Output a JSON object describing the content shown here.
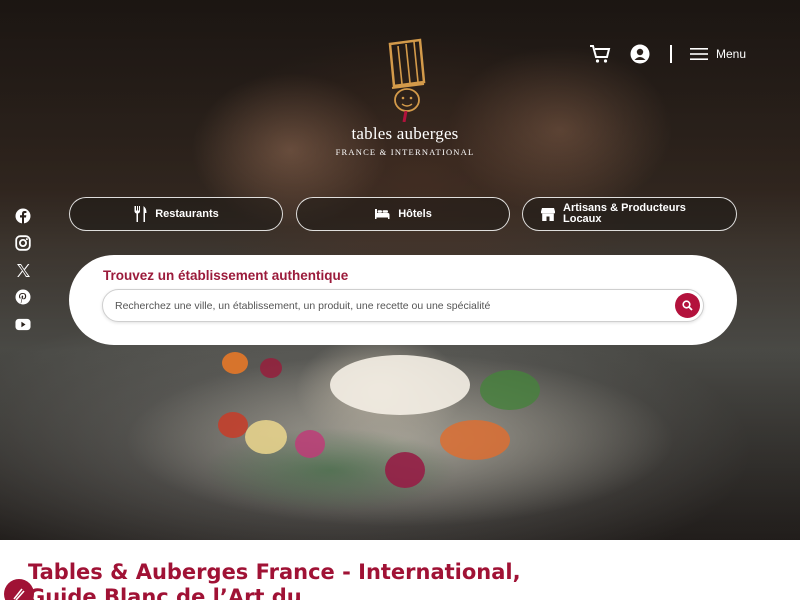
{
  "brand": {
    "name": "tables & auberges",
    "name_left": "tables",
    "name_right": "auberges",
    "tagline": "FRANCE & INTERNATIONAL",
    "hat_icon": "chef-hat-logo"
  },
  "header": {
    "cart_icon": "cart-icon",
    "account_icon": "user-icon",
    "menu_label": "Menu",
    "menu_icon": "hamburger-icon"
  },
  "social": [
    "facebook-icon",
    "instagram-icon",
    "x-icon",
    "pinterest-icon",
    "youtube-icon"
  ],
  "categories": [
    {
      "label": "Restaurants",
      "icon": "fork-knife-icon"
    },
    {
      "label": "Hôtels",
      "icon": "bed-icon"
    },
    {
      "label": "Artisans & Producteurs Locaux",
      "icon": "shop-icon"
    }
  ],
  "search": {
    "title": "Trouvez un établissement authentique",
    "placeholder": "Recherchez une ville, un établissement, un produit, une recette ou une spécialité",
    "button_icon": "search-icon"
  },
  "content": {
    "heading": "Tables & Auberges France - International, Guide Blanc de l’Art du"
  },
  "colors": {
    "accent": "#a01235",
    "search_title": "#9b1b3b",
    "white": "#ffffff"
  }
}
